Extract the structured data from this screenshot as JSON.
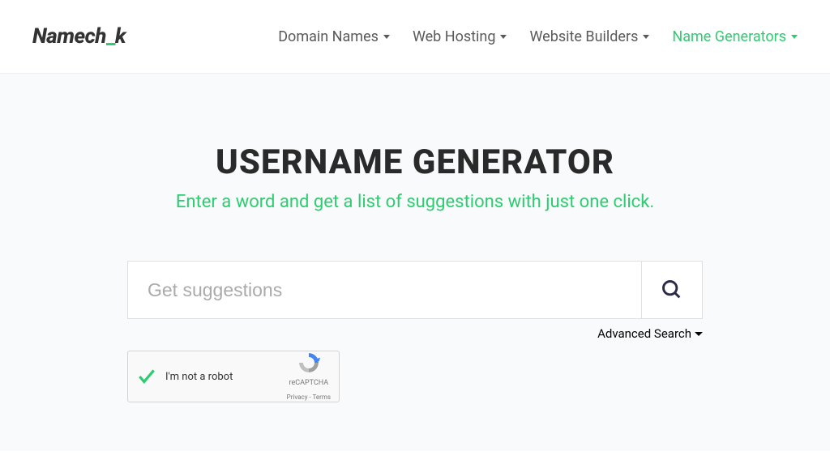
{
  "logo": {
    "part1": "Namech",
    "underscore": "_",
    "part2": "k"
  },
  "nav": {
    "items": [
      {
        "label": "Domain Names",
        "active": false
      },
      {
        "label": "Web Hosting",
        "active": false
      },
      {
        "label": "Website Builders",
        "active": false
      },
      {
        "label": "Name Generators",
        "active": true
      }
    ]
  },
  "main": {
    "title": "USERNAME GENERATOR",
    "subtitle": "Enter a word and get a list of suggestions with just one click.",
    "search_placeholder": "Get suggestions",
    "advanced_search_label": "Advanced Search"
  },
  "recaptcha": {
    "label": "I'm not a robot",
    "brand": "reCAPTCHA",
    "links": "Privacy - Terms"
  }
}
